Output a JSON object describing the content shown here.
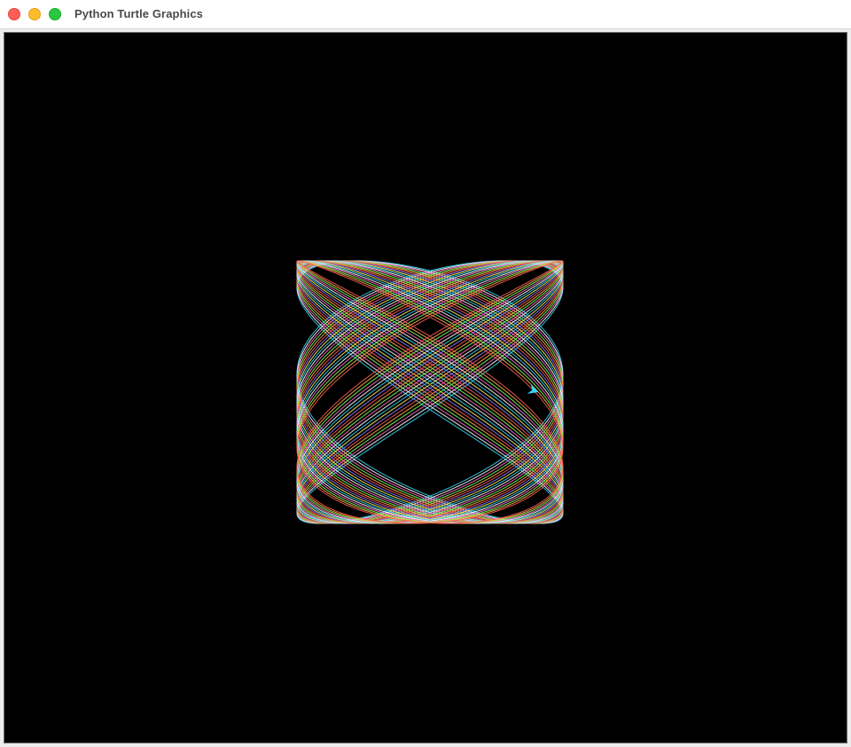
{
  "window": {
    "title": "Python Turtle Graphics"
  },
  "canvas": {
    "background": "#000000",
    "pen_colors": [
      "#33d6f5",
      "#ffffff",
      "#ff6fd2",
      "#7dff5a",
      "#ffb347",
      "#ff5a5a",
      "#8a7dff",
      "#fff25a"
    ]
  },
  "turtle": {
    "shape": "arrow-icon",
    "color": "#33d6f5"
  },
  "icons": {
    "close": "close-button-icon",
    "minimize": "minimize-button-icon",
    "zoom": "zoom-button-icon"
  }
}
